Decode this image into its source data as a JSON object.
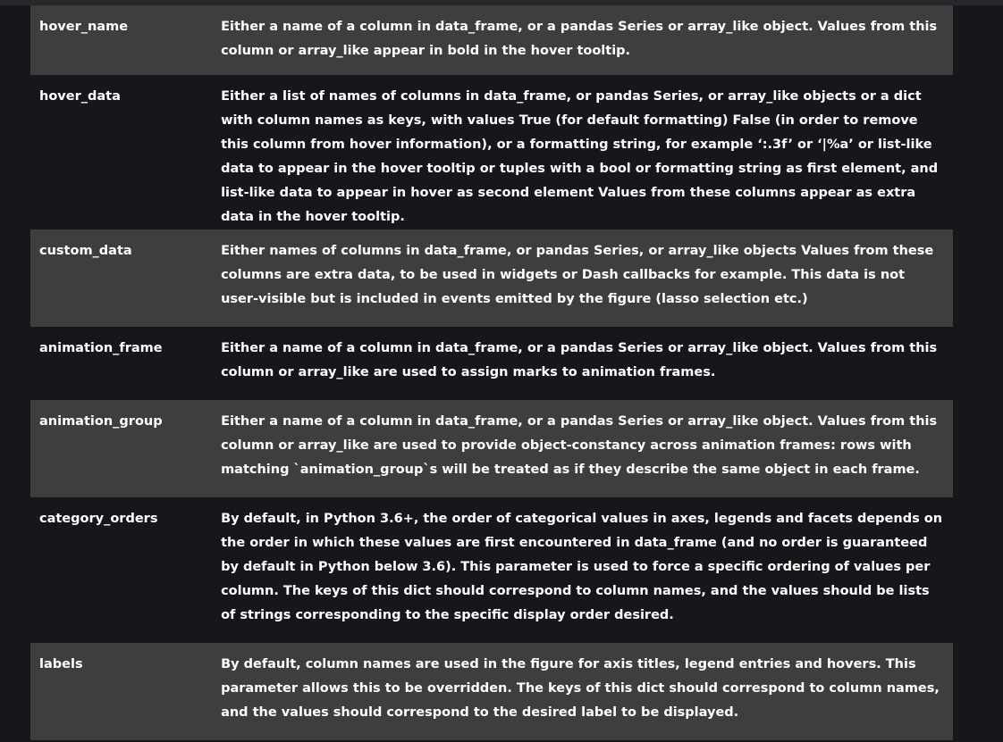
{
  "rows": [
    {
      "name": "hover_name",
      "description": "Either a name of a column in data_frame, or a pandas Series or array_like object. Values from this column or array_like appear in bold in the hover tooltip."
    },
    {
      "name": "hover_data",
      "description": "Either a list of names of columns in data_frame, or pandas Series, or array_like objects or a dict with column names as keys, with values True (for default formatting) False (in order to remove this column from hover information), or a formatting string, for example ‘:.3f’ or ‘|%a’ or list-like data to appear in the hover tooltip or tuples with a bool or formatting string as first element, and list-like data to appear in hover as second element Values from these columns appear as extra data in the hover tooltip."
    },
    {
      "name": "custom_data",
      "description": " Either names of columns in data_frame, or pandas Series, or array_like objects Values from these columns are extra data, to be used in widgets or Dash callbacks for example. This data is not user-visible but is included in events emitted by the figure (lasso selection etc.)"
    },
    {
      "name": "animation_frame",
      "description": "Either a name of a column in data_frame, or a pandas Series or array_like object. Values from this column or array_like are used to assign marks to animation frames."
    },
    {
      "name": "animation_group",
      "description": "Either a name of a column in data_frame, or a pandas Series or array_like object. Values from this column or array_like are used to provide object-constancy across animation frames: rows with matching `animation_group`s will be treated as if they describe the same object in each frame."
    },
    {
      "name": "category_orders",
      "description": " By default, in Python 3.6+, the order of categorical values in axes, legends and facets depends on the order in which these values are first encountered in data_frame (and no order is guaranteed by default in Python below 3.6). This parameter is used to force a specific ordering of values per column. The keys of this dict should correspond to column names, and the values should be lists of strings corresponding to the specific display order desired."
    },
    {
      "name": "labels",
      "description": "By default, column names are used in the figure for axis titles, legend entries and hovers. This parameter allows this to be overridden. The keys of this dict should correspond to column names, and the values should correspond to the desired label to be displayed."
    }
  ]
}
